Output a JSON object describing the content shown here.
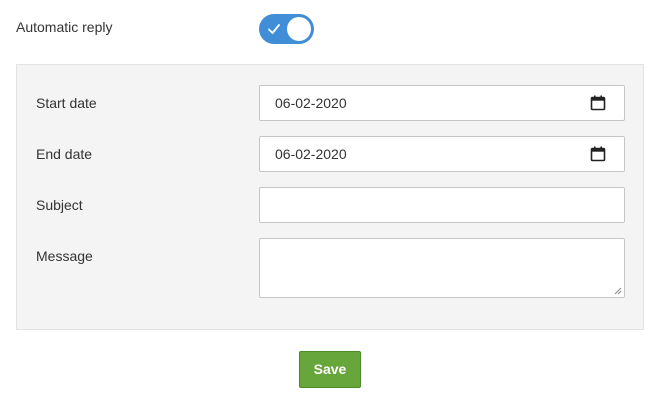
{
  "auto_reply": {
    "label": "Automatic reply",
    "enabled": true
  },
  "form": {
    "start_date": {
      "label": "Start date",
      "value": "06-02-2020"
    },
    "end_date": {
      "label": "End date",
      "value": "06-02-2020"
    },
    "subject": {
      "label": "Subject",
      "value": ""
    },
    "message": {
      "label": "Message",
      "value": ""
    }
  },
  "actions": {
    "save_label": "Save"
  },
  "colors": {
    "toggle_on": "#3f8ed7",
    "save_button": "#67a63a",
    "panel_bg": "#f4f4f5"
  },
  "icons": {
    "toggle": "check-icon",
    "date_picker": "calendar-icon"
  }
}
